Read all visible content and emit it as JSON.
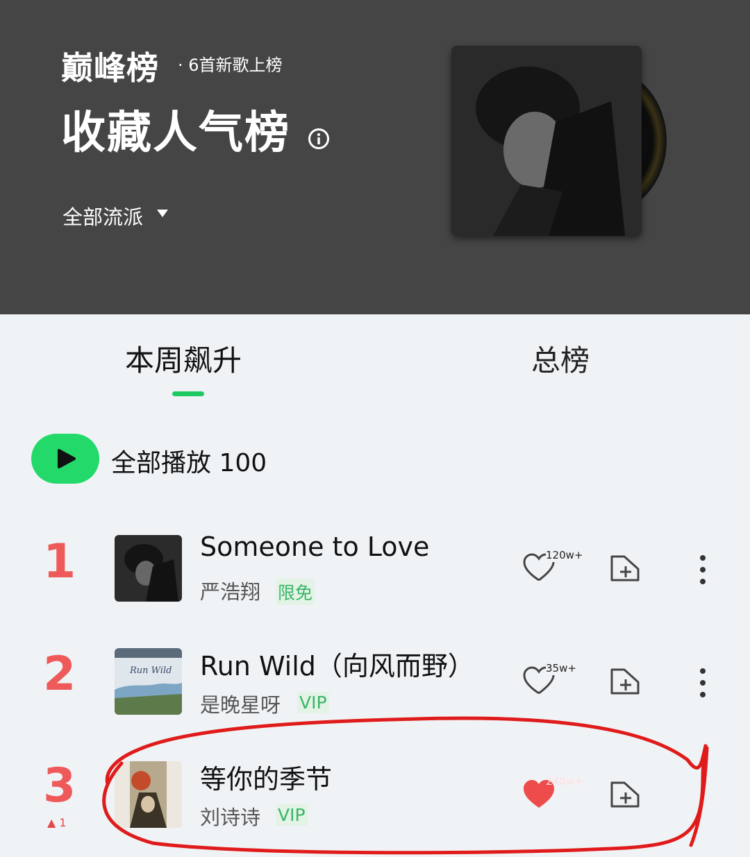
{
  "header": {
    "brand": "巅峰榜",
    "subtitle": "· 6首新歌上榜",
    "title": "收藏人气榜",
    "genre_filter": "全部流派"
  },
  "tabs": [
    {
      "label": "本周飙升",
      "active": true
    },
    {
      "label": "总榜",
      "active": false
    }
  ],
  "play_all": {
    "label": "全部播放 100"
  },
  "songs": [
    {
      "rank": "1",
      "title": "Someone to Love",
      "artist": "严浩翔",
      "tag": "限免",
      "likes": "120w+",
      "liked": false
    },
    {
      "rank": "2",
      "title": "Run Wild（向风而野）",
      "artist": "是晚星呀",
      "tag": "VIP",
      "likes": "35w+",
      "liked": false
    },
    {
      "rank": "3",
      "title": "等你的季节",
      "artist": "刘诗诗",
      "tag": "VIP",
      "likes": "240w+",
      "liked": true,
      "trend": "▲ 1"
    }
  ],
  "colors": {
    "accent_green": "#23d96a",
    "rank_red": "#ee5a5a",
    "header_bg": "#454545",
    "liked_red": "#ee4b4b",
    "annotation_red": "#e01b1b"
  }
}
